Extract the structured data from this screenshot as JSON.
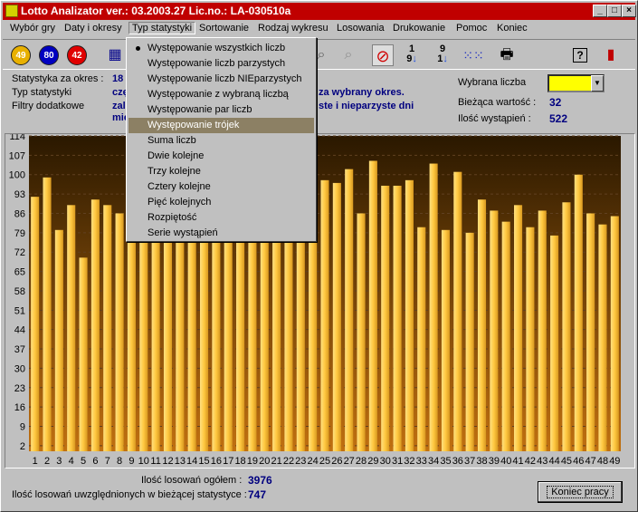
{
  "window": {
    "title": "Lotto Analizator ver.: 03.2003.27  Lic.no.: LA-030510a"
  },
  "menu": [
    {
      "id": "wybor",
      "label": "Wybór gry"
    },
    {
      "id": "daty",
      "label": "Daty i okresy"
    },
    {
      "id": "typ",
      "label": "Typ statystyki"
    },
    {
      "id": "sort",
      "label": "Sortowanie"
    },
    {
      "id": "rodzaj",
      "label": "Rodzaj wykresu"
    },
    {
      "id": "losowania",
      "label": "Losowania"
    },
    {
      "id": "druk",
      "label": "Drukowanie"
    },
    {
      "id": "pomoc",
      "label": "Pomoc"
    },
    {
      "id": "koniec",
      "label": "Koniec"
    }
  ],
  "toolbar": {
    "balls": [
      {
        "label": "49",
        "color": "#e8b000"
      },
      {
        "label": "80",
        "color": "#0000c0"
      },
      {
        "label": "42",
        "color": "#e00000"
      }
    ]
  },
  "info": {
    "stat_okres_label": "Statystyka za okres :",
    "stat_okres_value": "18",
    "typ_label": "Typ statystyki",
    "typ_value": "czę",
    "filtry_label": "Filtry dodatkowe",
    "filtry_value1": "zal",
    "filtry_value2": "mie",
    "desc1": "za wybrany okres.",
    "desc2": "ste i nieparzyste dni",
    "wybrana_label": "Wybrana liczba",
    "biezaca_label": "Bieżąca wartość :",
    "biezaca_value": "32",
    "ilosc_label": "Ilość wystąpień :",
    "ilosc_value": "522"
  },
  "dropdown": {
    "items": [
      {
        "label": "Występowanie wszystkich liczb",
        "checked": true
      },
      {
        "label": "Występowanie liczb parzystych"
      },
      {
        "label": "Występowanie liczb NIEparzystych"
      },
      {
        "label": "Występowanie z wybraną liczbą"
      },
      {
        "label": "Występowanie par liczb"
      },
      {
        "label": "Występowanie trójek",
        "highlighted": true
      },
      {
        "label": "Suma liczb"
      },
      {
        "label": "Dwie kolejne"
      },
      {
        "label": "Trzy kolejne"
      },
      {
        "label": "Cztery kolejne"
      },
      {
        "label": "Pięć kolejnych"
      },
      {
        "label": "Rozpiętość"
      },
      {
        "label": "Serie wystąpień"
      }
    ]
  },
  "bottom": {
    "losowan_label": "Ilość losowań ogółem :",
    "losowan_value": "3976",
    "uwzgl_label": "Ilość losowań uwzględnionych w bieżącej statystyce :",
    "uwzgl_value": "747",
    "koniec_button": "Koniec pracy"
  },
  "chart_data": {
    "type": "bar",
    "categories": [
      "1",
      "2",
      "3",
      "4",
      "5",
      "6",
      "7",
      "8",
      "9",
      "10",
      "11",
      "12",
      "13",
      "14",
      "15",
      "16",
      "17",
      "18",
      "19",
      "20",
      "21",
      "22",
      "23",
      "24",
      "25",
      "26",
      "27",
      "28",
      "29",
      "30",
      "31",
      "32",
      "33",
      "34",
      "35",
      "36",
      "37",
      "38",
      "39",
      "40",
      "41",
      "42",
      "43",
      "44",
      "45",
      "46",
      "47",
      "48",
      "49"
    ],
    "values": [
      92,
      99,
      80,
      89,
      70,
      91,
      89,
      86,
      80,
      82,
      82,
      82,
      82,
      82,
      82,
      82,
      82,
      82,
      82,
      82,
      82,
      82,
      82,
      82,
      98,
      97,
      102,
      86,
      105,
      96,
      96,
      98,
      81,
      104,
      80,
      101,
      79,
      91,
      87,
      83,
      89,
      81,
      87,
      78,
      90,
      100,
      86,
      82,
      85
    ],
    "yticks": [
      "2",
      "9",
      "16",
      "23",
      "30",
      "37",
      "44",
      "51",
      "58",
      "65",
      "72",
      "79",
      "86",
      "93",
      "100",
      "107",
      "114"
    ],
    "ylim": [
      0,
      114
    ],
    "bar_color": "#ffc840",
    "bg_top": "#2a1800",
    "bg_bottom": "#c07010"
  }
}
